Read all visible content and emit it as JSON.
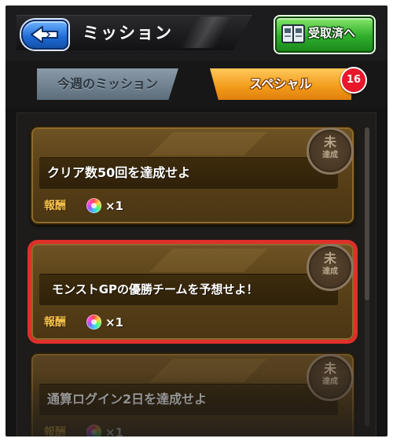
{
  "header": {
    "title": "ミッション",
    "claimed_button_label": "受取済へ"
  },
  "tabs": [
    {
      "label": "今週のミッション",
      "active": false
    },
    {
      "label": "スペシャル",
      "active": true
    }
  ],
  "special_badge_count": "16",
  "missions": [
    {
      "text": "クリア数50回を達成せよ",
      "reward_label": "報酬",
      "reward_qty": "×1",
      "stamp_top": "未",
      "stamp_bottom": "達成",
      "selected": false
    },
    {
      "text": "モンストGPの優勝チームを予想せよ！",
      "reward_label": "報酬",
      "reward_qty": "×1",
      "stamp_top": "未",
      "stamp_bottom": "達成",
      "selected": true
    },
    {
      "text": "通算ログイン2日を達成せよ",
      "reward_label": "報酬",
      "reward_qty": "×1",
      "stamp_top": "未",
      "stamp_bottom": "達成",
      "selected": false
    }
  ],
  "icons": {
    "back": "back-arrow-icon",
    "claimed": "book-icon",
    "reward": "rainbow-orb-icon"
  },
  "colors": {
    "active_tab": "#f29a1a",
    "inactive_tab": "#6e7f8d",
    "badge": "#e6182a",
    "claimed_button": "#2fae2c",
    "back_button": "#1e6ad6",
    "selection_outline": "#e0302a"
  }
}
